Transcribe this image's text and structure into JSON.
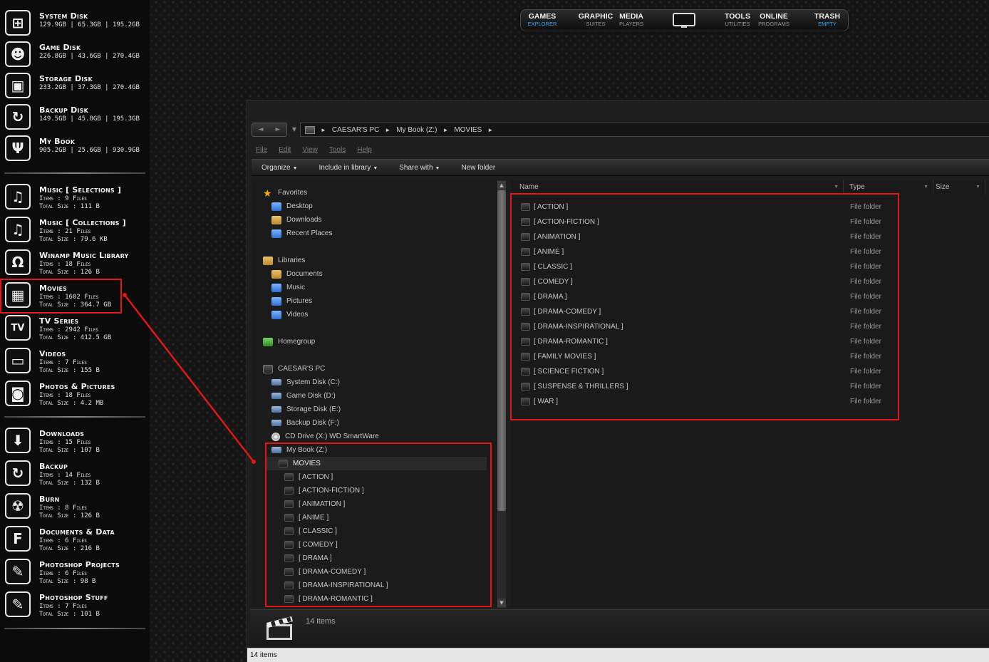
{
  "sidebar": {
    "disks": [
      {
        "title": "System Disk",
        "stats": "129.9GB | 65.3GB | 195.2GB",
        "icon": "windows-logo-icon"
      },
      {
        "title": "Game Disk",
        "stats": "226.8GB | 43.6GB | 270.4GB",
        "icon": "alien-icon"
      },
      {
        "title": "Storage Disk",
        "stats": "233.2GB | 37.3GB | 270.4GB",
        "icon": "briefcase-icon"
      },
      {
        "title": "Backup Disk",
        "stats": "149.5GB | 45.8GB | 195.3GB",
        "icon": "sync-icon"
      },
      {
        "title": "My Book",
        "stats": "905.2GB | 25.6GB | 930.9GB",
        "icon": "usb-icon"
      }
    ],
    "libraries": [
      {
        "title": "Music [ Selections ]",
        "items": "Items : 9 Files",
        "size": "Total Size : 111 B",
        "icon": "music-note-icon"
      },
      {
        "title": "Music [ Collections ]",
        "items": "Items : 21 Files",
        "size": "Total Size : 79.6 KB",
        "icon": "music-note-icon"
      },
      {
        "title": "Winamp Music Library",
        "items": "Items : 18 Files",
        "size": "Total Size : 126 B",
        "icon": "headphones-icon"
      },
      {
        "title": "Movies",
        "items": "Items : 1602 Files",
        "size": "Total Size : 364.7 GB",
        "icon": "clapperboard-icon"
      },
      {
        "title": "TV Series",
        "items": "Items : 2942 Files",
        "size": "Total Size : 412.5 GB",
        "icon": "tv-icon"
      },
      {
        "title": "Videos",
        "items": "Items : 7 Files",
        "size": "Total Size : 155 B",
        "icon": "video-icon"
      },
      {
        "title": "Photos & Pictures",
        "items": "Items : 18 Files",
        "size": "Total Size : 4.2 MB",
        "icon": "camera-icon"
      }
    ],
    "folders": [
      {
        "title": "Downloads",
        "items": "Items : 15 Files",
        "size": "Total Size : 107 B",
        "icon": "download-arrow-icon"
      },
      {
        "title": "Backup",
        "items": "Items : 14 Files",
        "size": "Total Size : 132 B",
        "icon": "sync-icon"
      },
      {
        "title": "Burn",
        "items": "Items : 8 Files",
        "size": "Total Size : 126 B",
        "icon": "radiation-icon"
      },
      {
        "title": "Documents & Data",
        "items": "Items : 6 Files",
        "size": "Total Size : 216 B",
        "icon": "letter-f-icon"
      },
      {
        "title": "Photoshop Projects",
        "items": "Items : 6 Files",
        "size": "Total Size : 98 B",
        "icon": "feather-icon"
      },
      {
        "title": "Photoshop Stuff",
        "items": "Items : 7 Files",
        "size": "Total Size : 101 B",
        "icon": "feather-icon"
      }
    ]
  },
  "dock": {
    "buttons": [
      {
        "main": "GAMES",
        "sub": "EXPLORER",
        "sub_color": "blue"
      },
      {
        "main": "GRAPHIC",
        "sub": "SUITES",
        "sub_color": "gray"
      },
      {
        "main": "MEDIA",
        "sub": "PLAYERS",
        "sub_color": "gray"
      },
      {
        "main": "TOOLS",
        "sub": "UTILITIES",
        "sub_color": "gray"
      },
      {
        "main": "ONLINE",
        "sub": "PROGRAMS",
        "sub_color": "gray"
      },
      {
        "main": "TRASH",
        "sub": "EMPTY",
        "sub_color": "blue"
      }
    ]
  },
  "explorer": {
    "breadcrumbs": [
      "CAESAR'S PC",
      "My Book (Z:)",
      "MOVIES"
    ],
    "menu": [
      "File",
      "Edit",
      "View",
      "Tools",
      "Help"
    ],
    "commands": {
      "organize": "Organize",
      "include": "Include in library",
      "share": "Share with",
      "new_folder": "New folder"
    },
    "nav": {
      "favorites": {
        "label": "Favorites",
        "items": [
          "Desktop",
          "Downloads",
          "Recent Places"
        ]
      },
      "libraries": {
        "label": "Libraries",
        "items": [
          "Documents",
          "Music",
          "Pictures",
          "Videos"
        ]
      },
      "homegroup": "Homegroup",
      "computer": {
        "label": "CAESAR'S PC",
        "items": [
          "System Disk (C:)",
          "Game Disk (D:)",
          "Storage Disk (E:)",
          "Backup Disk (F:)",
          "CD Drive (X:) WD SmartWare"
        ]
      },
      "mybook": "My Book (Z:)",
      "movies": "MOVIES",
      "subfolders": [
        "[ ACTION ]",
        "[ ACTION-FICTION ]",
        "[ ANIMATION ]",
        "[ ANIME ]",
        "[ CLASSIC ]",
        "[ COMEDY ]",
        "[ DRAMA ]",
        "[ DRAMA-COMEDY ]",
        "[ DRAMA-INSPIRATIONAL ]",
        "[ DRAMA-ROMANTIC ]"
      ]
    },
    "columns": {
      "name": "Name",
      "type": "Type",
      "size": "Size"
    },
    "files": [
      {
        "name": "[ ACTION ]",
        "type": "File folder"
      },
      {
        "name": "[ ACTION-FICTION ]",
        "type": "File folder"
      },
      {
        "name": "[ ANIMATION ]",
        "type": "File folder"
      },
      {
        "name": "[ ANIME ]",
        "type": "File folder"
      },
      {
        "name": "[ CLASSIC ]",
        "type": "File folder"
      },
      {
        "name": "[ COMEDY ]",
        "type": "File folder"
      },
      {
        "name": "[ DRAMA ]",
        "type": "File folder"
      },
      {
        "name": "[ DRAMA-COMEDY ]",
        "type": "File folder"
      },
      {
        "name": "[ DRAMA-INSPIRATIONAL ]",
        "type": "File folder"
      },
      {
        "name": "[ DRAMA-ROMANTIC ]",
        "type": "File folder"
      },
      {
        "name": "[ FAMILY MOVIES ]",
        "type": "File folder"
      },
      {
        "name": "[ SCIENCE FICTION ]",
        "type": "File folder"
      },
      {
        "name": "[ SUSPENSE & THRILLERS ]",
        "type": "File folder"
      },
      {
        "name": "[ WAR ]",
        "type": "File folder"
      }
    ],
    "details_count": "14 items",
    "status": "14 items"
  },
  "colors": {
    "highlight": "#e01818",
    "accent_blue": "#37a7ff"
  }
}
